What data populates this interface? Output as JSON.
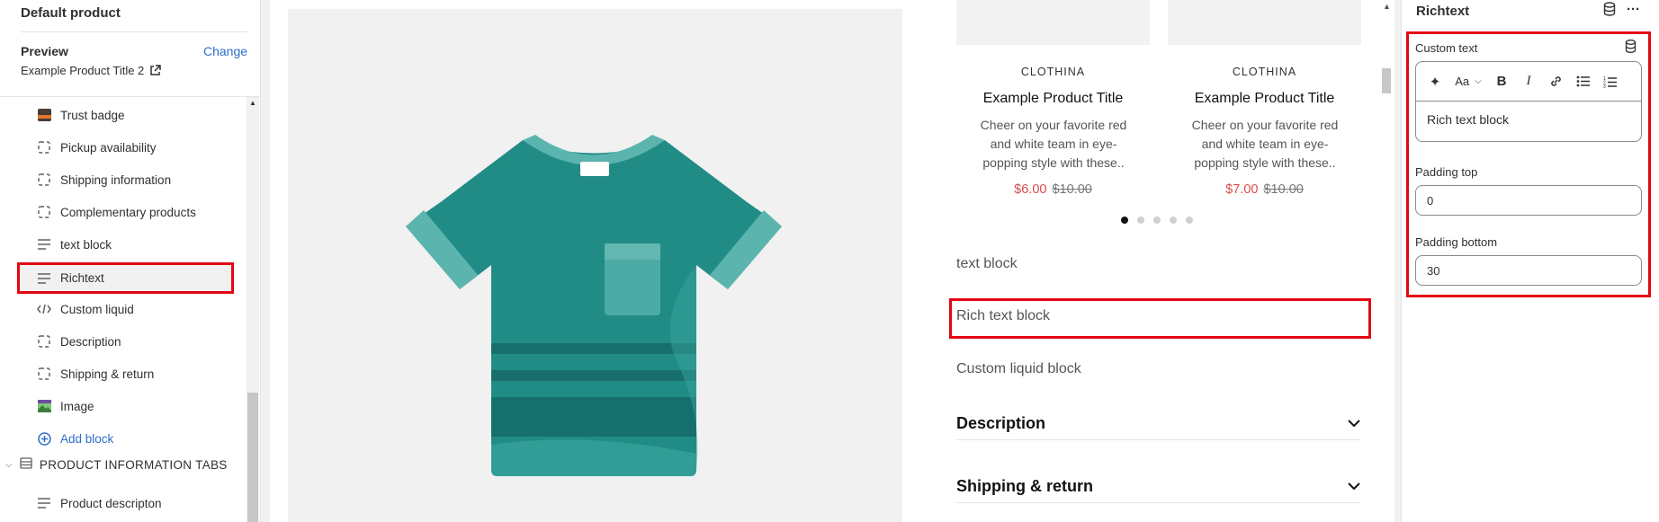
{
  "sidebar": {
    "title": "Default product",
    "preview_label": "Preview",
    "change_label": "Change",
    "preview_value": "Example Product Title 2",
    "items": [
      {
        "label": "Trust badge",
        "icon": "image-thumbnail-icon"
      },
      {
        "label": "Pickup availability",
        "icon": "dashed-square-icon"
      },
      {
        "label": "Shipping information",
        "icon": "dashed-square-icon"
      },
      {
        "label": "Complementary products",
        "icon": "dashed-square-icon"
      },
      {
        "label": "text block",
        "icon": "text-lines-icon"
      },
      {
        "label": "Richtext",
        "icon": "text-lines-icon"
      },
      {
        "label": "Custom liquid",
        "icon": "code-icon"
      },
      {
        "label": "Description",
        "icon": "dashed-square-icon"
      },
      {
        "label": "Shipping & return",
        "icon": "dashed-square-icon"
      },
      {
        "label": "Image",
        "icon": "image-icon"
      }
    ],
    "add_block": "Add block",
    "group_label": "PRODUCT INFORMATION TABS",
    "group_item": "Product descripton"
  },
  "canvas": {
    "cards": [
      {
        "vendor": "CLOTHINA",
        "title": "Example Product Title",
        "desc": "Cheer on your favorite red and white team in eye-popping style with these..",
        "sale": "$6.00",
        "orig": "$10.00"
      },
      {
        "vendor": "CLOTHINA",
        "title": "Example Product Title",
        "desc": "Cheer on your favorite red and white team in eye-popping style with these..",
        "sale": "$7.00",
        "orig": "$10.00"
      }
    ],
    "blocks": {
      "text_block": "text block",
      "rich_text": "Rich text block",
      "custom_liquid": "Custom liquid block"
    },
    "accordions": [
      "Description",
      "Shipping & return"
    ],
    "dots": 5,
    "active_dot": 0
  },
  "panel": {
    "title": "Richtext",
    "custom_text_label": "Custom text",
    "editor_content": "Rich text block",
    "padding_top_label": "Padding top",
    "padding_top_value": "0",
    "padding_bottom_label": "Padding bottom",
    "padding_bottom_value": "30"
  },
  "colors": {
    "accent_link": "#2c6ecb",
    "highlight": "#e30613",
    "sale": "#d94c4c",
    "shirt_main": "#218c86",
    "shirt_light": "#5bb5ae",
    "shirt_dark": "#15706d"
  }
}
